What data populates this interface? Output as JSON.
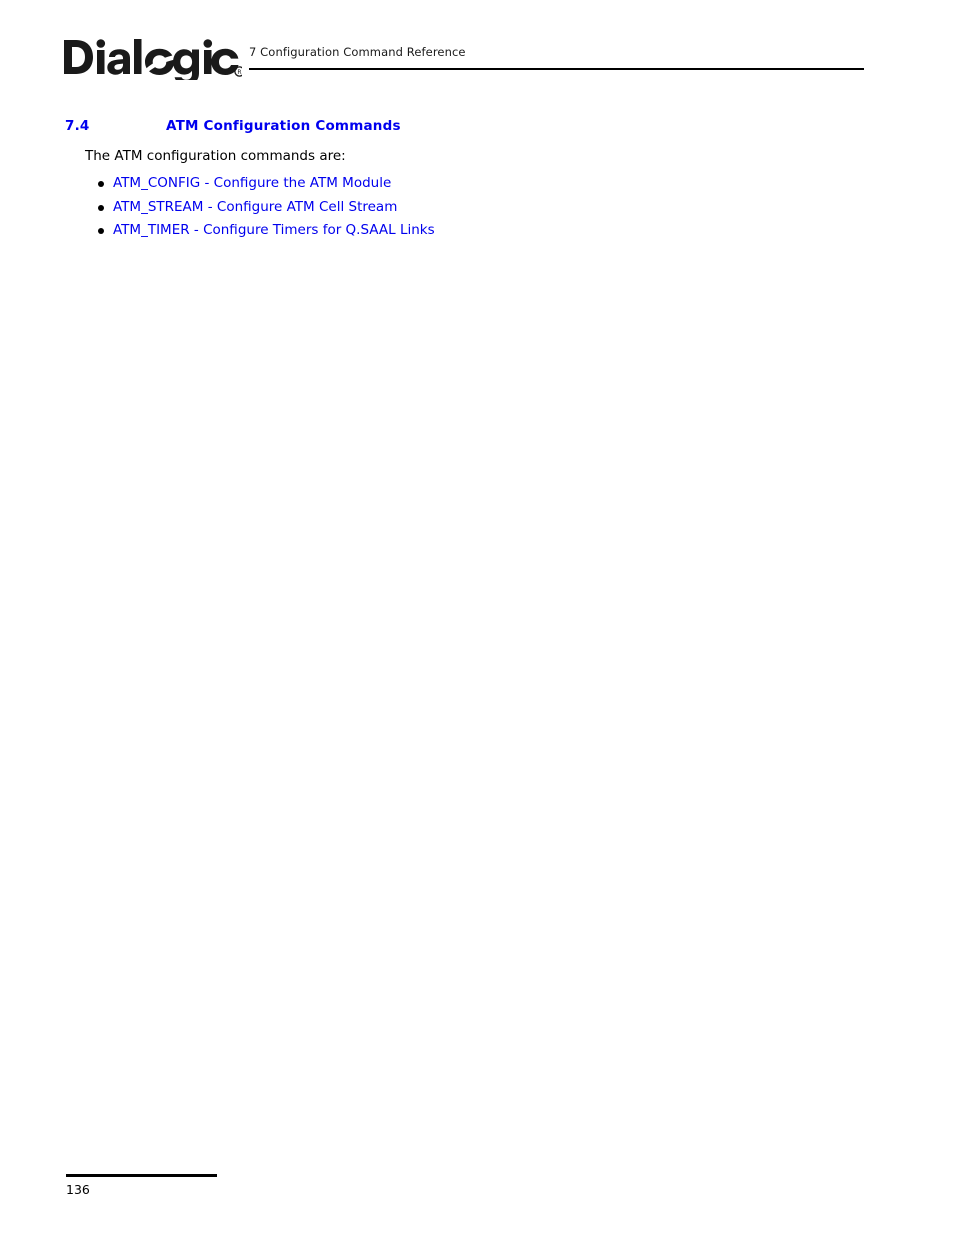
{
  "document": {
    "header": {
      "logo_text": "Dialogic",
      "logo_trademark": "®",
      "logo_name": "dialogic-logo",
      "running_head": "7 Configuration Command Reference"
    },
    "section": {
      "number": "7.4",
      "title": "ATM Configuration Commands"
    },
    "intro": "The ATM configuration commands are:",
    "commands": [
      {
        "name": "ATM_CONFIG",
        "separator": " - ",
        "description": "Configure the ATM Module",
        "full": "ATM_CONFIG - Configure the ATM Module"
      },
      {
        "name": "ATM_STREAM",
        "separator": " - ",
        "description": "Configure ATM Cell Stream",
        "full": "ATM_STREAM - Configure ATM Cell Stream"
      },
      {
        "name": "ATM_TIMER",
        "separator": " - ",
        "description": "Configure Timers for Q.SAAL Links",
        "full": "ATM_TIMER - Configure Timers for Q.SAAL Links"
      }
    ],
    "footer": {
      "page_number": "136"
    },
    "colors": {
      "link_blue": "#0000EE",
      "heading_blue": "#0000EE",
      "body_black": "#000000",
      "page_background": "#FFFFFF"
    }
  }
}
